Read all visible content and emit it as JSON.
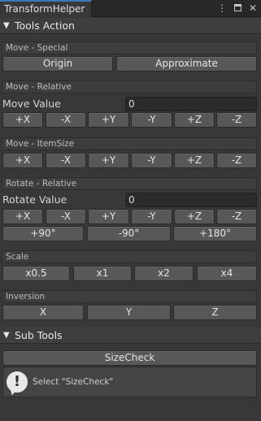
{
  "window": {
    "tab_title": "TransformHelper",
    "menu_icon": "kebab-menu-icon",
    "maximize_icon": "maximize-icon",
    "close_icon": "close-icon"
  },
  "tools_action": {
    "label": "Tools Action",
    "move_special": {
      "header": "Move - Special",
      "buttons": [
        "Origin",
        "Approximate"
      ]
    },
    "move_relative": {
      "header": "Move - Relative",
      "field_label": "Move Value",
      "field_value": "0",
      "buttons": [
        "+X",
        "-X",
        "+Y",
        "-Y",
        "+Z",
        "-Z"
      ]
    },
    "move_itemsize": {
      "header": "Move - ItemSize",
      "buttons": [
        "+X",
        "-X",
        "+Y",
        "-Y",
        "+Z",
        "-Z"
      ]
    },
    "rotate_relative": {
      "header": "Rotate - Relative",
      "field_label": "Rotate Value",
      "field_value": "0",
      "buttons": [
        "+X",
        "-X",
        "+Y",
        "-Y",
        "+Z",
        "-Z"
      ],
      "angle_buttons": [
        "+90°",
        "-90°",
        "+180°"
      ]
    },
    "scale": {
      "header": "Scale",
      "buttons": [
        "x0.5",
        "x1",
        "x2",
        "x4"
      ]
    },
    "inversion": {
      "header": "Inversion",
      "buttons": [
        "X",
        "Y",
        "Z"
      ]
    }
  },
  "sub_tools": {
    "label": "Sub Tools",
    "size_check_button": "SizeCheck",
    "help_text": "Select \"SizeCheck\"",
    "help_icon": "info-speech-bubble-icon"
  }
}
